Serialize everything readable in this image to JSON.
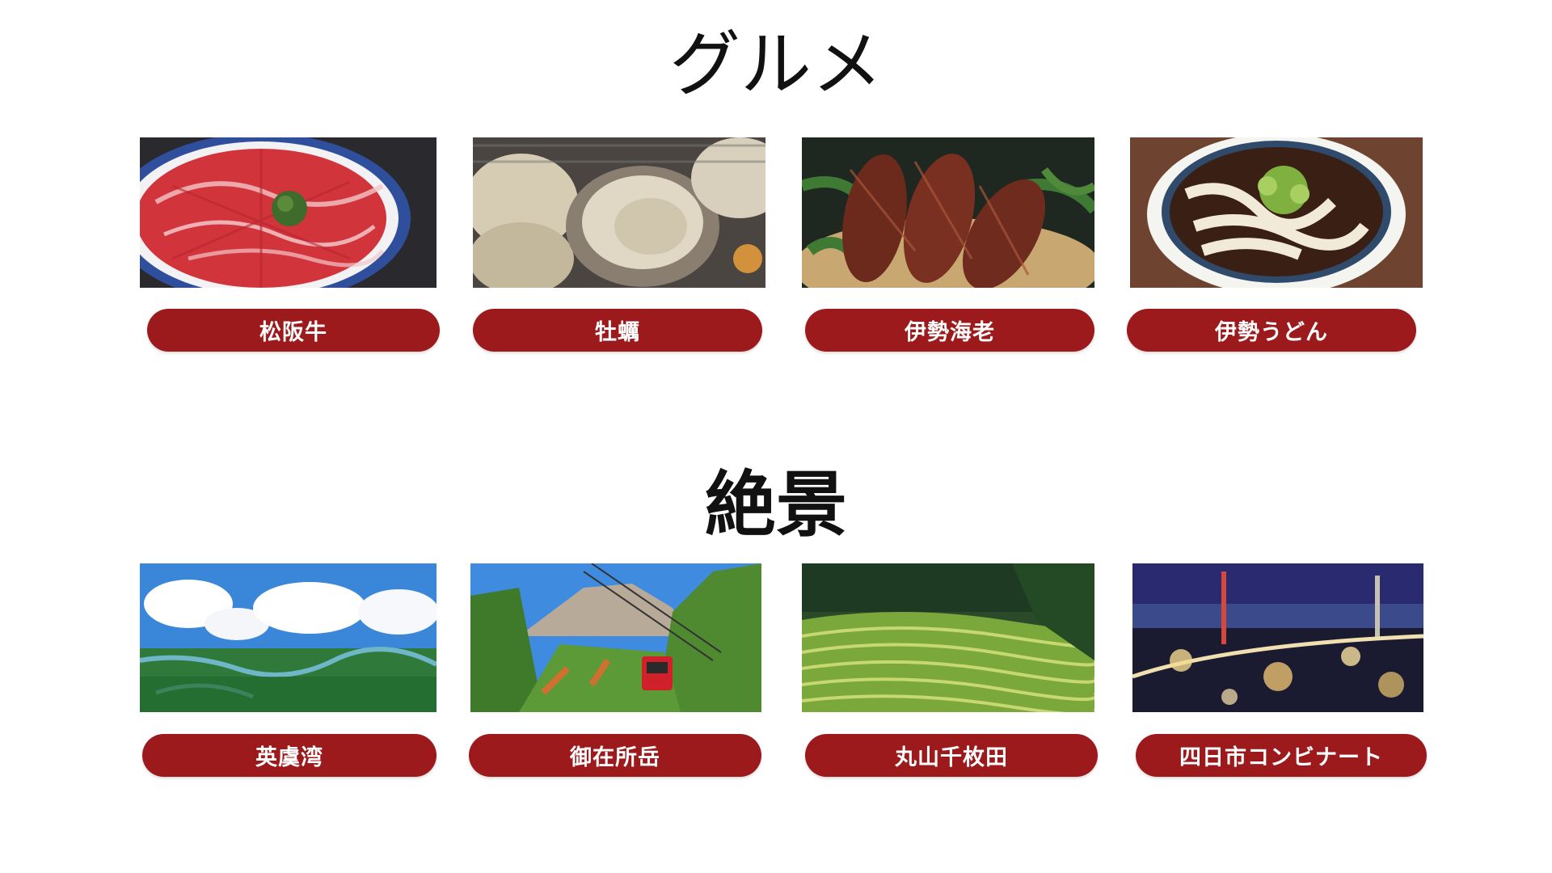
{
  "colors": {
    "pill": "#9d1a1c",
    "title": "#111111",
    "background": "#ffffff"
  },
  "gourmet": {
    "title": "グルメ",
    "items": [
      {
        "label": "松阪牛",
        "image": "matsusaka-beef-photo"
      },
      {
        "label": "牡蠣",
        "image": "oyster-photo"
      },
      {
        "label": "伊勢海老",
        "image": "spiny-lobster-photo"
      },
      {
        "label": "伊勢うどん",
        "image": "ise-udon-photo"
      }
    ]
  },
  "scenery": {
    "title": "絶景",
    "items": [
      {
        "label": "英虞湾",
        "image": "ago-bay-photo"
      },
      {
        "label": "御在所岳",
        "image": "gozaisho-ropeway-photo"
      },
      {
        "label": "丸山千枚田",
        "image": "maruyama-rice-terraces-photo"
      },
      {
        "label": "四日市コンビナート",
        "image": "yokkaichi-industrial-night-photo"
      }
    ]
  }
}
